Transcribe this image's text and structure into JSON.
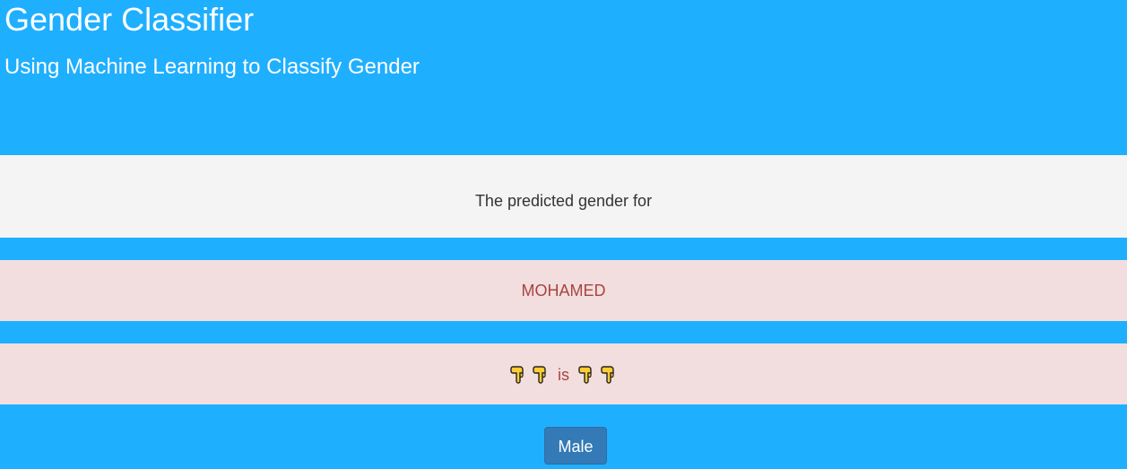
{
  "header": {
    "title": "Gender Classifier",
    "subtitle": "Using Machine Learning to Classify Gender"
  },
  "result": {
    "intro_text": "The predicted gender for",
    "name": "MOHAMED",
    "connector_word": "is",
    "leading_icons": [
      "pointing-down-icon",
      "pointing-down-icon"
    ],
    "trailing_icons": [
      "pointing-down-icon",
      "pointing-down-icon"
    ],
    "gender_label": "Male"
  },
  "colors": {
    "page_background": "#1fafff",
    "info_panel": "#f4f4f4",
    "alert_panel": "#f2dede",
    "alert_text": "#a94442",
    "button": "#337ab7"
  }
}
